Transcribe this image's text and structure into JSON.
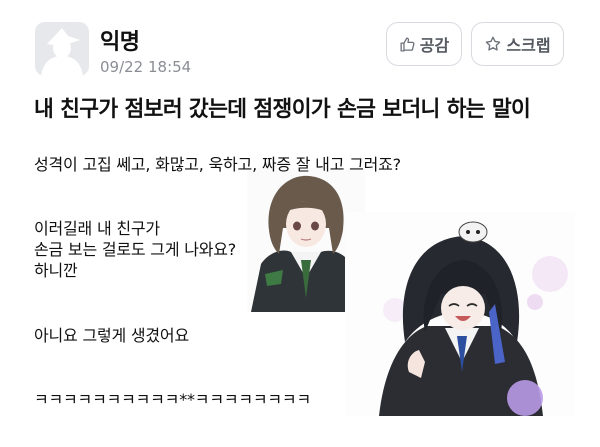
{
  "author": {
    "name": "익명",
    "time": "09/22 18:54"
  },
  "actions": {
    "like_label": "공감",
    "scrap_label": "스크랩"
  },
  "post": {
    "title": "내 친구가 점보러 갔는데 점쟁이가 손금 보더니 하는 말이",
    "lines": [
      "성격이 고집 쎄고, 화많고, 욱하고, 짜증 잘 내고 그러죠?",
      "이러길래 내 친구가",
      "손금 보는 걸로도 그게 나와요?",
      "하니깐",
      "아니요 그렇게 생겼어요",
      "ㅋㅋㅋㅋㅋㅋㅋㅋㅋㅋ**ㅋㅋㅋㅋㅋㅋㅋㅋ"
    ]
  },
  "icons": {
    "avatar": "anonymous-avatar-icon",
    "like": "thumbs-up-icon",
    "scrap": "star-icon"
  },
  "colors": {
    "muted_text": "#8a8d94",
    "button_border": "#d8dadf",
    "avatar_bg": "#e7e8ec"
  }
}
